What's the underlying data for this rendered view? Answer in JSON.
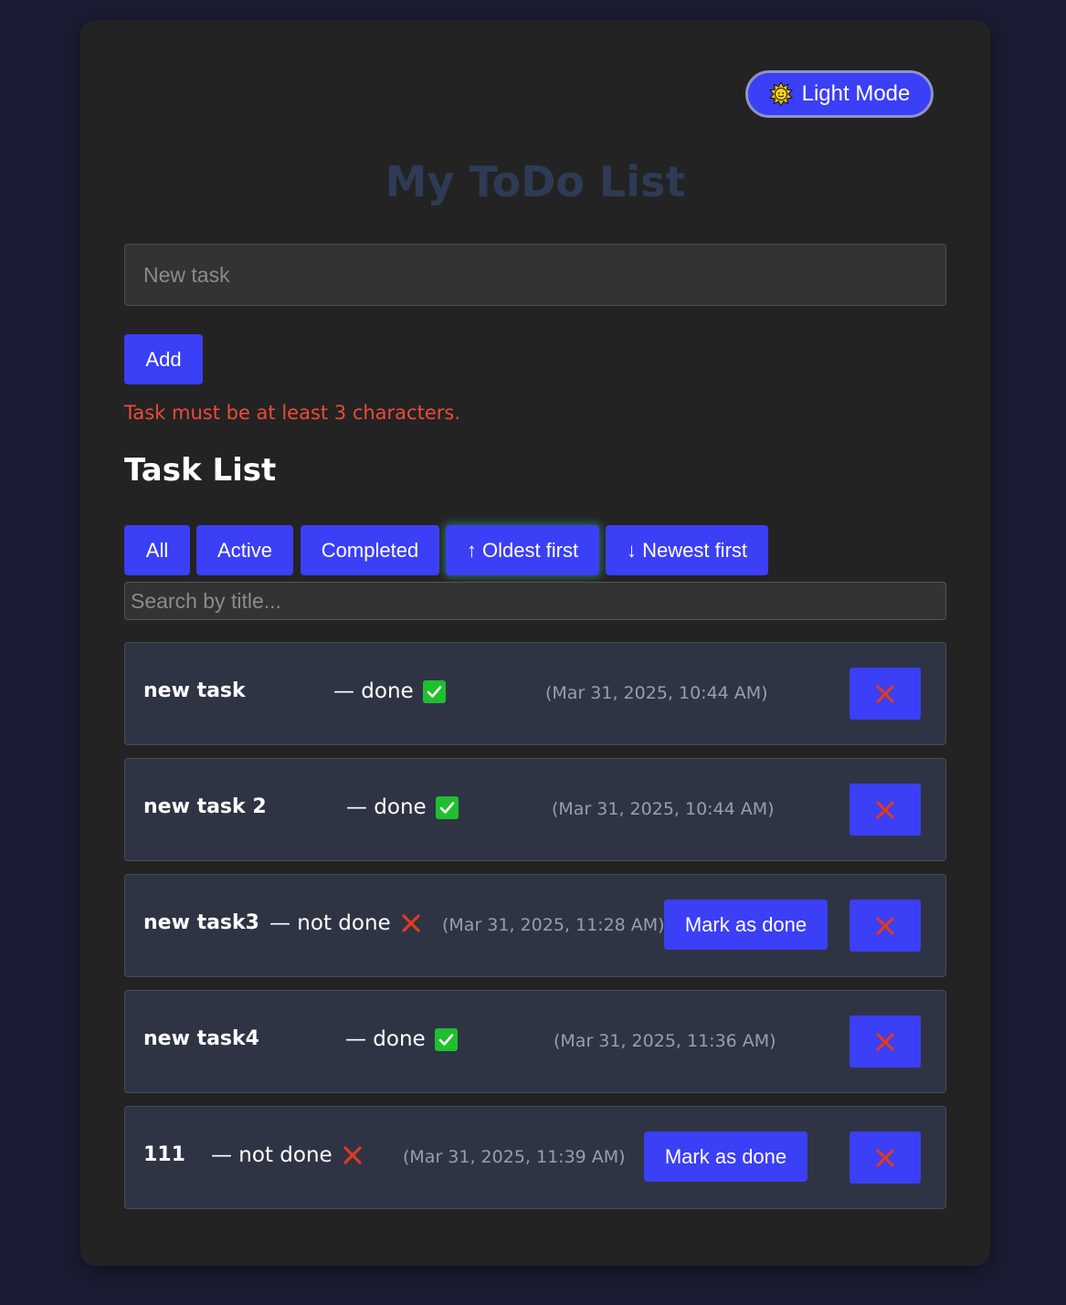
{
  "theme_toggle": {
    "label": "Light Mode",
    "icon": "sun-icon"
  },
  "page_title": "My ToDo List",
  "new_task": {
    "placeholder": "New task",
    "value": ""
  },
  "add_label": "Add",
  "error_message": "Task must be at least 3 characters.",
  "section_title": "Task List",
  "filters": {
    "all": "All",
    "active": "Active",
    "completed": "Completed",
    "oldest": "↑ Oldest first",
    "newest": "↓ Newest first"
  },
  "search": {
    "placeholder": "Search by title..."
  },
  "tasks": [
    {
      "title": "new task",
      "status": "— done",
      "done": true,
      "date": "(Mar 31, 2025, 10:44 AM)"
    },
    {
      "title": "new task 2",
      "status": "— done",
      "done": true,
      "date": "(Mar 31, 2025, 10:44 AM)"
    },
    {
      "title": "new task3",
      "status": "— not done",
      "done": false,
      "date": "(Mar 31, 2025, 11:28 AM)",
      "action": "Mark as done"
    },
    {
      "title": "new task4",
      "status": "— done",
      "done": true,
      "date": "(Mar 31, 2025, 11:36 AM)"
    },
    {
      "title": "111",
      "status": "— not done",
      "done": false,
      "date": "(Mar 31, 2025, 11:39 AM)",
      "action": "Mark as done"
    }
  ],
  "colors": {
    "accent": "#3b3ff5",
    "error": "#ee4a3a",
    "done": "#1fbf2f",
    "not_done": "#e03a1e"
  }
}
